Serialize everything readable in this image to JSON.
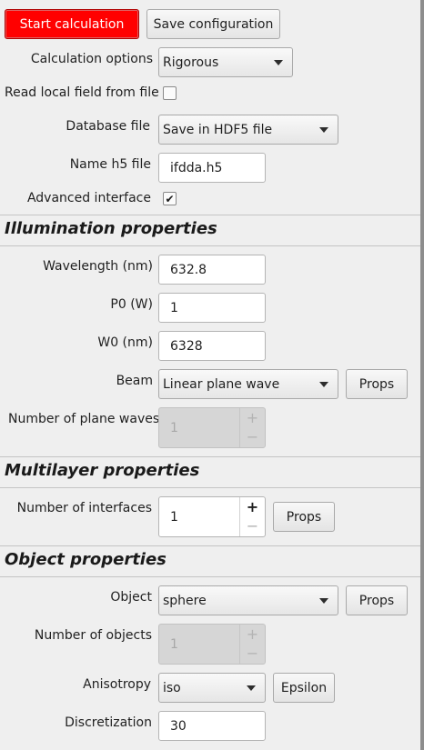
{
  "toolbar": {
    "start_label": "Start calculation",
    "save_label": "Save configuration"
  },
  "general": {
    "calc_options_label": "Calculation options",
    "calc_options_value": "Rigorous",
    "read_local_field_label": "Read local field from file",
    "read_local_field_checked": false,
    "database_label": "Database file",
    "database_value": "Save in HDF5 file",
    "h5_name_label": "Name h5 file",
    "h5_name_value": "ifdda.h5",
    "advanced_label": "Advanced interface",
    "advanced_checked": true
  },
  "illumination": {
    "title": "Illumination properties",
    "wavelength_label": "Wavelength (nm)",
    "wavelength_value": "632.8",
    "p0_label": "P0 (W)",
    "p0_value": "1",
    "w0_label": "W0 (nm)",
    "w0_value": "6328",
    "beam_label": "Beam",
    "beam_value": "Linear plane wave",
    "beam_props_label": "Props",
    "num_plane_waves_label": "Number of plane waves",
    "num_plane_waves_value": "1"
  },
  "multilayer": {
    "title": "Multilayer properties",
    "num_interfaces_label": "Number of interfaces",
    "num_interfaces_value": "1",
    "props_label": "Props"
  },
  "object": {
    "title": "Object properties",
    "object_label": "Object",
    "object_value": "sphere",
    "props_label": "Props",
    "num_objects_label": "Number of objects",
    "num_objects_value": "1",
    "anisotropy_label": "Anisotropy",
    "anisotropy_value": "iso",
    "epsilon_label": "Epsilon",
    "discretization_label": "Discretization",
    "discretization_value": "30"
  },
  "icons": {
    "checkmark": "✔",
    "plus": "+",
    "minus": "−"
  },
  "colors": {
    "start_button_bg": "#ff0000",
    "background": "#efefef"
  }
}
